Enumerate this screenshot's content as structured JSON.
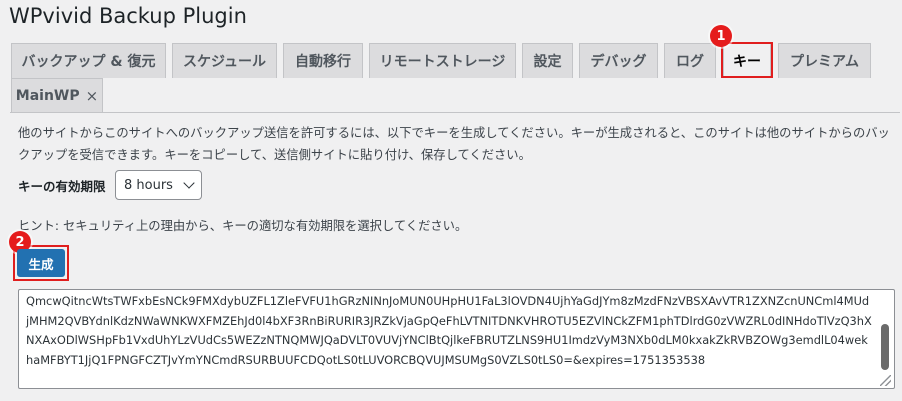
{
  "page": {
    "title": "WPvivid Backup Plugin"
  },
  "tabs": [
    {
      "label": "バックアップ & 復元"
    },
    {
      "label": "スケジュール"
    },
    {
      "label": "自動移行"
    },
    {
      "label": "リモートストレージ"
    },
    {
      "label": "設定"
    },
    {
      "label": "デバッグ"
    },
    {
      "label": "ログ"
    },
    {
      "label": "キー"
    },
    {
      "label": "プレミアム"
    },
    {
      "label": "MainWP",
      "close": "×"
    }
  ],
  "markers": {
    "one": "1",
    "two": "2"
  },
  "content": {
    "description": "他のサイトからこのサイトへのバックアップ送信を許可するには、以下でキーを生成してください。キーが生成されると、このサイトは他のサイトからのバックアップを受信できます。キーをコピーして、送信側サイトに貼り付け、保存してください。",
    "expiry_label": "キーの有効期限",
    "expiry_value": "8 hours",
    "hint": "ヒント: セキュリティ上の理由から、キーの適切な有効期限を選択してください。",
    "generate_label": "生成",
    "key_text": "QmcwQitncWtsTWFxbEsNCk9FMXdybUZFL1ZleFVFU1hGRzNINnJoMUN0UHpHU1FaL3lOVDN4UjhYaGdJYm8zMzdFNzVBSXAvVTR1ZXNZcnUNCml4MUdjMHM2QVBYdnlKdzNWaWNKWXFMZEhJd0l4bXF3RnBiRURIR3JRZkVjaGpQeFhLVTNITDNKVHROTU5EZVlNCkZFM1phTDlrdG0zVWZRL0dINHdoTlVzQ3hXNXAxODlWSHpFb1VxdUhYLzVUdCs5WEZzNTNQMWJQaDVLT0VUVjYNClBtQjlkeFBRUTZLNS9HU1ImdzVyM3NXb0dLM0kxakZkRVBZOWg3emdlL04wekhaMFBYT1JjQ1FPNGFCZTJvYmYNCmdRSURBUUFCDQotLS0tLUVORCBQVUJMSUMgS0VZLS0tLS0=&expires=1751353538"
  }
}
